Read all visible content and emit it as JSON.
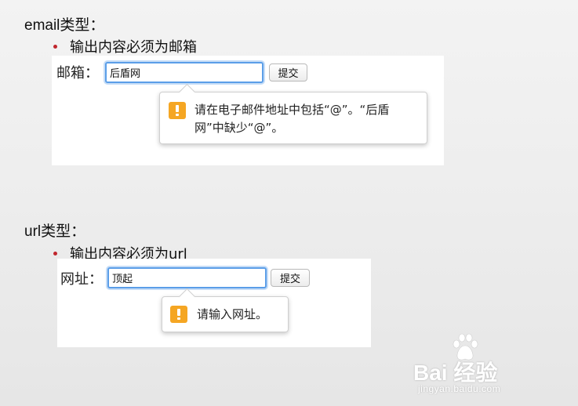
{
  "email_section": {
    "heading": "email类型：",
    "bullet": "输出内容必须为邮箱",
    "label": "邮箱：",
    "input_value": "后盾网",
    "submit_label": "提交",
    "tooltip_line1": "请在电子邮件地址中包括“@”。“后盾",
    "tooltip_line2": "网”中缺少“@”。"
  },
  "url_section": {
    "heading": "url类型：",
    "bullet": "输出内容必须为url",
    "label": "网址：",
    "input_value": "顶起",
    "submit_label": "提交",
    "tooltip_text": "请输入网址。"
  },
  "watermark": {
    "logo": "Bai 经验",
    "sub": "jingyan.baidu.com"
  },
  "colors": {
    "bullet": "#c0262d",
    "focus_ring": "#5b9ee8",
    "warning": "#f5a623"
  },
  "icons": [
    "warning-icon",
    "baidu-paw-icon"
  ]
}
